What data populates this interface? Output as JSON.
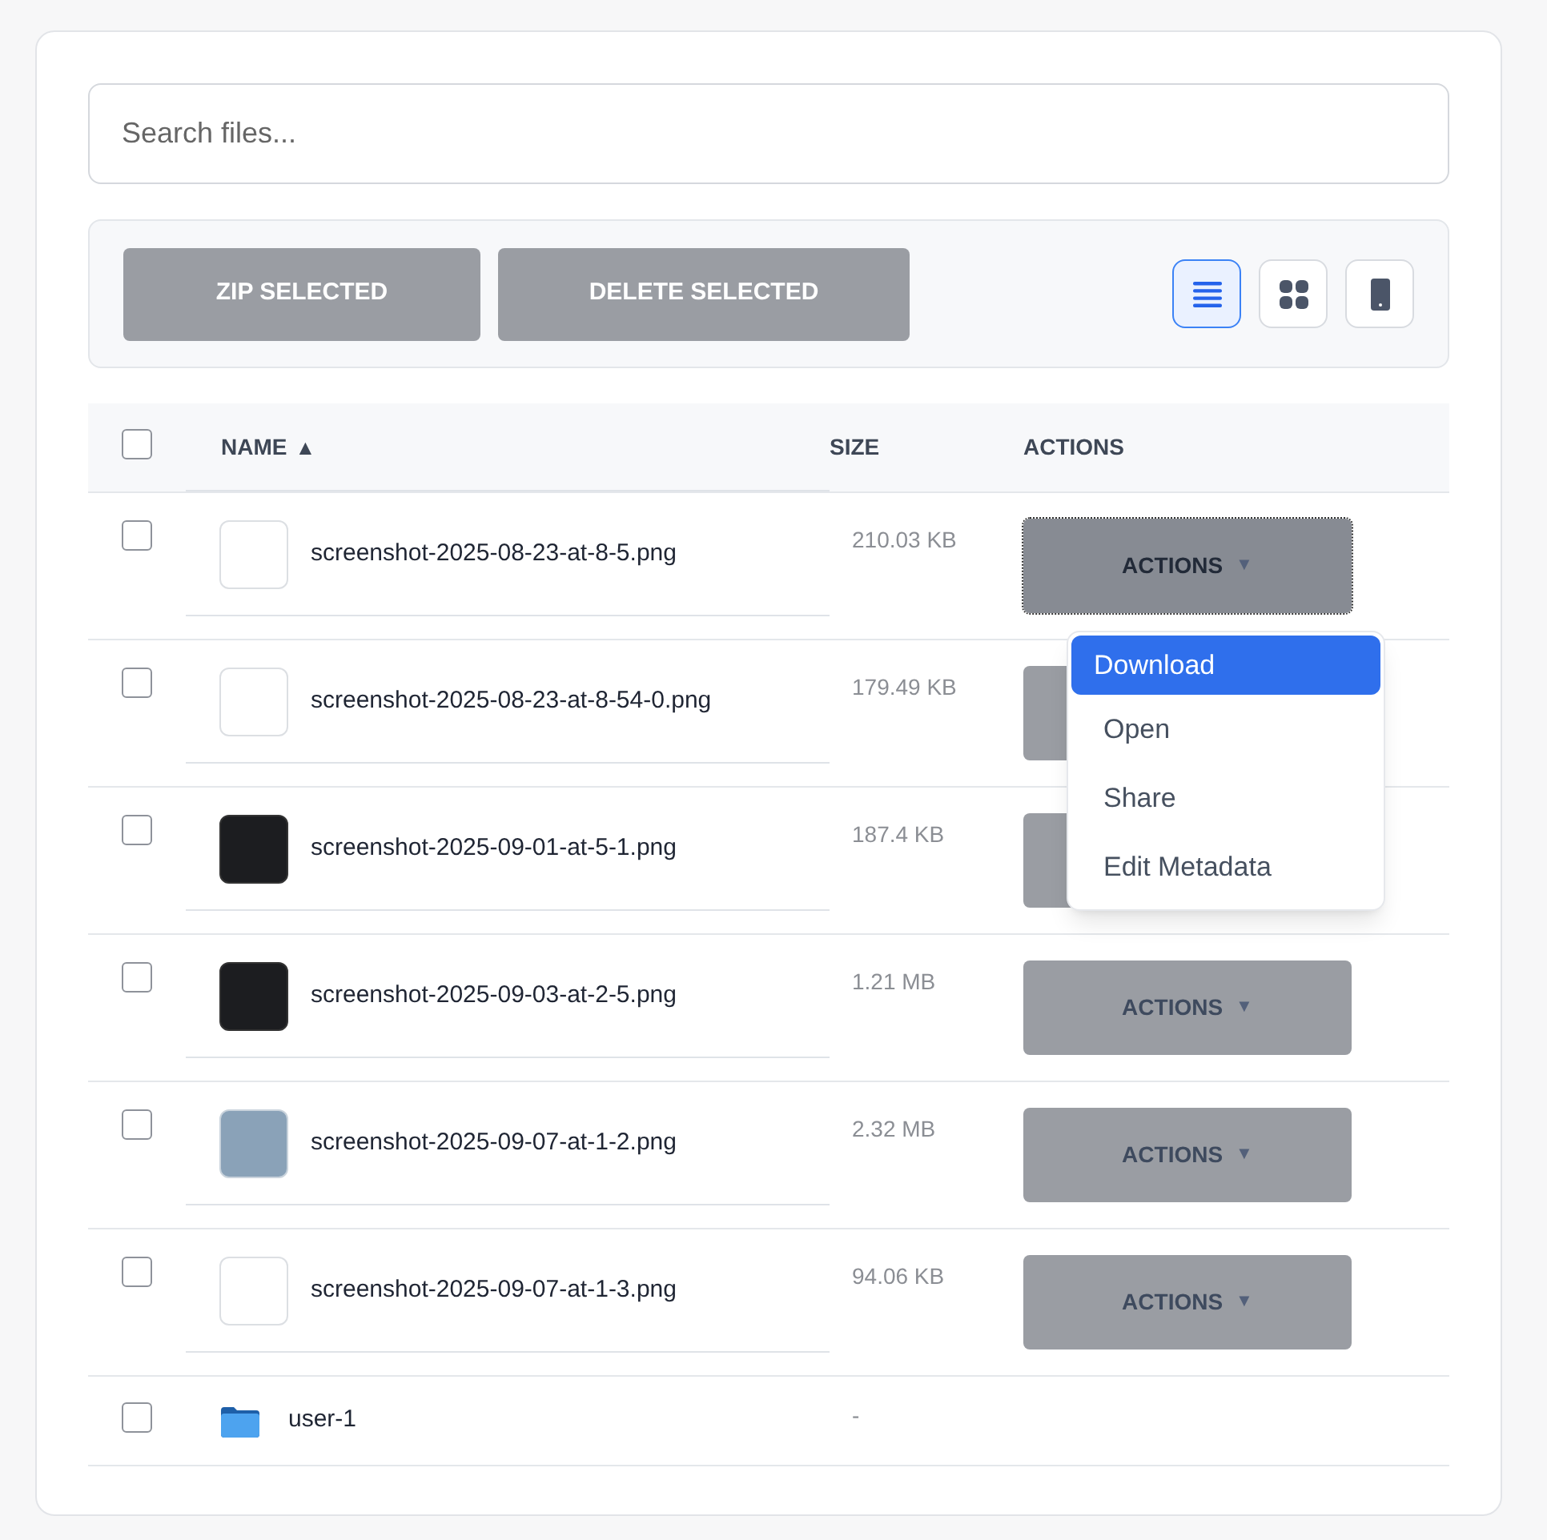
{
  "search": {
    "placeholder": "Search files..."
  },
  "toolbar": {
    "buttons": [
      "ZIP SELECTED",
      "DELETE SELECTED"
    ],
    "views": [
      {
        "kind": "list",
        "selected": true
      },
      {
        "kind": "grid",
        "selected": false
      },
      {
        "kind": "phone",
        "selected": false
      }
    ]
  },
  "table": {
    "select_all": {
      "checked": false
    },
    "columns": [
      {
        "label": "NAME",
        "sort_indicator": "▲"
      },
      {
        "label": "SIZE"
      },
      {
        "label": "ACTIONS"
      }
    ],
    "rows": [
      {
        "kind": "file",
        "checked": false,
        "thumbnail": {
          "kind": "light"
        },
        "name": "screenshot-2025-08-23-at-8-5.png",
        "size": "210.03 KB",
        "actions": {
          "label": "ACTIONS",
          "caret": "▼",
          "open": true
        }
      },
      {
        "kind": "file",
        "checked": false,
        "thumbnail": {
          "kind": "light"
        },
        "name": "screenshot-2025-08-23-at-8-54-0.png",
        "size": "179.49 KB",
        "actions": {
          "open": false
        }
      },
      {
        "kind": "file",
        "checked": false,
        "thumbnail": {
          "kind": "dark"
        },
        "name": "screenshot-2025-09-01-at-5-1.png",
        "size": "187.4 KB",
        "actions": {
          "open": false
        }
      },
      {
        "kind": "file",
        "checked": false,
        "thumbnail": {
          "kind": "dark"
        },
        "name": "screenshot-2025-09-03-at-2-5.png",
        "size": "1.21 MB",
        "actions": {
          "label": "ACTIONS",
          "caret": "▼",
          "open": false
        }
      },
      {
        "kind": "file",
        "checked": false,
        "thumbnail": {
          "kind": "photo"
        },
        "name": "screenshot-2025-09-07-at-1-2.png",
        "size": "2.32 MB",
        "actions": {
          "label": "ACTIONS",
          "caret": "▼",
          "open": false
        }
      },
      {
        "kind": "file",
        "checked": false,
        "thumbnail": {
          "kind": "blank"
        },
        "name": "screenshot-2025-09-07-at-1-3.png",
        "size": "94.06 KB",
        "actions": {
          "label": "ACTIONS",
          "caret": "▼",
          "open": false
        }
      },
      {
        "kind": "folder",
        "checked": false,
        "name": "user-1",
        "size": "-"
      }
    ]
  },
  "dropdown_menu": {
    "items": [
      {
        "label": "Download",
        "selected": true
      },
      {
        "label": "Open",
        "selected": false
      },
      {
        "label": "Share",
        "selected": false
      },
      {
        "label": "Edit Metadata",
        "selected": false
      }
    ]
  }
}
